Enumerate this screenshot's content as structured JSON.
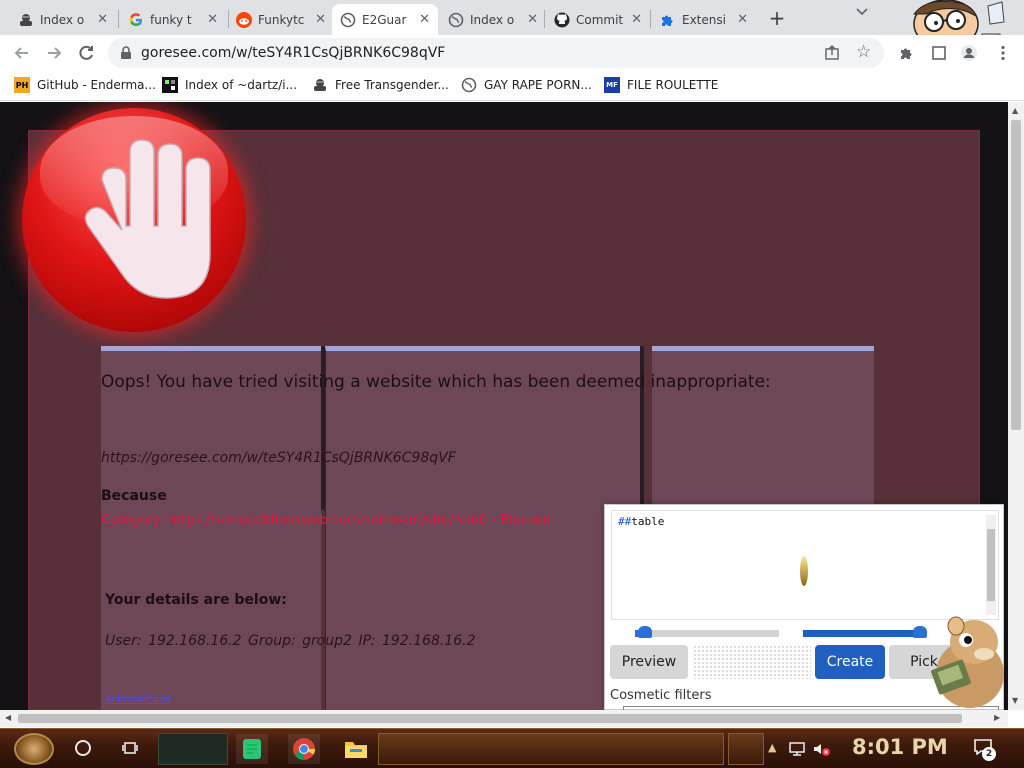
{
  "tabs": [
    {
      "label": "Index o",
      "icon": "spy-icon",
      "active": false
    },
    {
      "label": "funky t",
      "icon": "google-icon",
      "active": false
    },
    {
      "label": "Funkytc",
      "icon": "reddit-icon",
      "active": false
    },
    {
      "label": "E2Guar",
      "icon": "globe-icon",
      "active": true
    },
    {
      "label": "Index o",
      "icon": "globe-icon",
      "active": false
    },
    {
      "label": "Commit",
      "icon": "github-icon",
      "active": false
    },
    {
      "label": "Extensi",
      "icon": "puzzle-icon",
      "active": false
    }
  ],
  "toolbar": {
    "url": "goresee.com/w/teSY4R1CsQjBRNK6C98qVF"
  },
  "bookmarks": [
    {
      "label": "GitHub - Enderma...",
      "icon": "ph-icon",
      "badge": "PH"
    },
    {
      "label": "Index of ~dartz/i...",
      "icon": "pixel-icon",
      "badge": ""
    },
    {
      "label": "Free Transgender...",
      "icon": "spy-icon",
      "badge": ""
    },
    {
      "label": "GAY RAPE PORN...",
      "icon": "globe-icon",
      "badge": ""
    },
    {
      "label": "FILE ROULETTE",
      "icon": "mf-icon",
      "badge": "MF"
    }
  ],
  "page": {
    "title": "Oops! You have tried visiting a website which has been deemed inappropriate:",
    "blocked_url": "https://goresee.com/w/teSY4R1CsQjBRNK6C98qVF",
    "because_label": "Because",
    "category_text": "Category: https://someaddressweb.com/some-url/site/rule0 - Blocked",
    "details_heading": "Your details are below:",
    "user_line": "User: 192.168.16.2    Group: group2    IP: 192.168.16.2",
    "acknowledge": "Acknowledge"
  },
  "picker": {
    "filter_hash": "##",
    "filter_text": "table",
    "preview_label": "Preview",
    "create_label": "Create",
    "pick_label": "Pick",
    "cosmetic_label": "Cosmetic filters",
    "slider1_value": 0.05,
    "slider2_value": 0.85
  },
  "taskbar": {
    "time": "8:01 PM",
    "notifications": "2"
  },
  "colors": {
    "panel": "#573039",
    "alert_red": "#e8143a",
    "accent_blue": "#1f5fbf"
  }
}
